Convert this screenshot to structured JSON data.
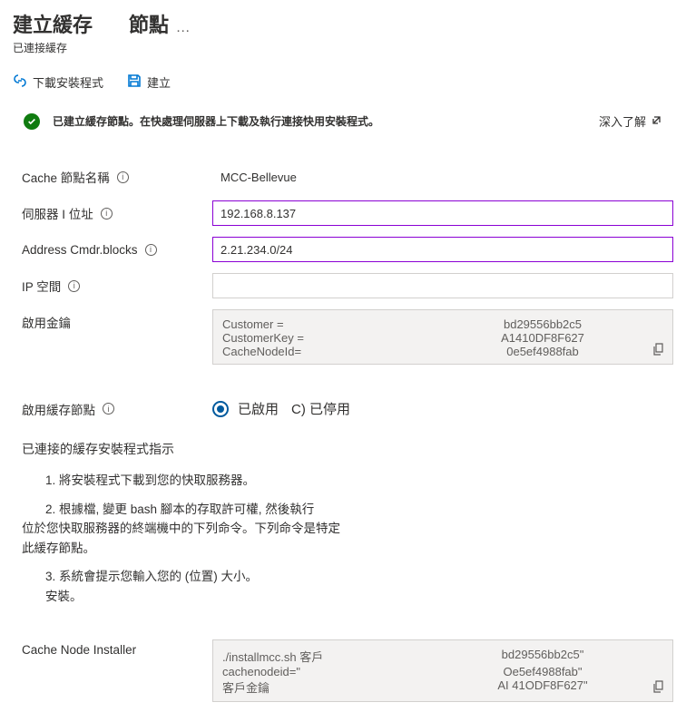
{
  "header": {
    "title": "建立緩存",
    "subtitle": "節點",
    "ellipsis": "…",
    "caption": "已連接緩存"
  },
  "toolbar": {
    "download": "下載安裝程式",
    "create": "建立"
  },
  "banner": {
    "message": "已建立緩存節點。在快處理伺服器上下載及執行連接快用安裝程式。",
    "learn_more": "深入了解"
  },
  "fields": {
    "cache_name": {
      "label": "Cache 節點名稱",
      "value": "MCC-Bellevue"
    },
    "server_ip": {
      "label": "伺服器 I 位址",
      "value": "192.168.8.137"
    },
    "addr_blocks": {
      "label": "Address Cmdr.blocks",
      "value": "2.21.234.0/24"
    },
    "ip_space": {
      "label": "IP 空間",
      "value": ""
    },
    "act_keys": {
      "label": "啟用金鑰",
      "rows": [
        {
          "k": "Customer =",
          "v": "bd29556bb2c5"
        },
        {
          "k": "CustomerKey =",
          "v": "A1410DF8F627"
        },
        {
          "k": "CacheNodeId=",
          "v": "0e5ef4988fab"
        }
      ]
    },
    "enable_node": {
      "label": "啟用緩存節點",
      "enabled": "已啟用",
      "disabled": "C) 已停用"
    }
  },
  "instructions": {
    "heading": "已連接的緩存安裝程式指示",
    "step1": "1. 將安裝程式下載到您的快取服務器。",
    "step2": "2. 根據檔, 變更 bash 腳本的存取許可權, 然後執行",
    "step2b": "位於您快取服務器的終端機中的下列命令。下列命令是特定",
    "step2c": "此緩存節點。",
    "step3": "3. 系統會提示您輸入您的 (位置) 大小。",
    "step3b": "安裝。"
  },
  "installer": {
    "label": "Cache Node Installer",
    "rows": [
      {
        "k": "./installmcc.sh 客戶",
        "v": "bd29556bb2c5\""
      },
      {
        "k": "cachenodeid=\"",
        "v": "Oe5ef4988fab\""
      },
      {
        "k": "客戶金鑰",
        "v": "AI 41ODF8F627\""
      }
    ]
  }
}
